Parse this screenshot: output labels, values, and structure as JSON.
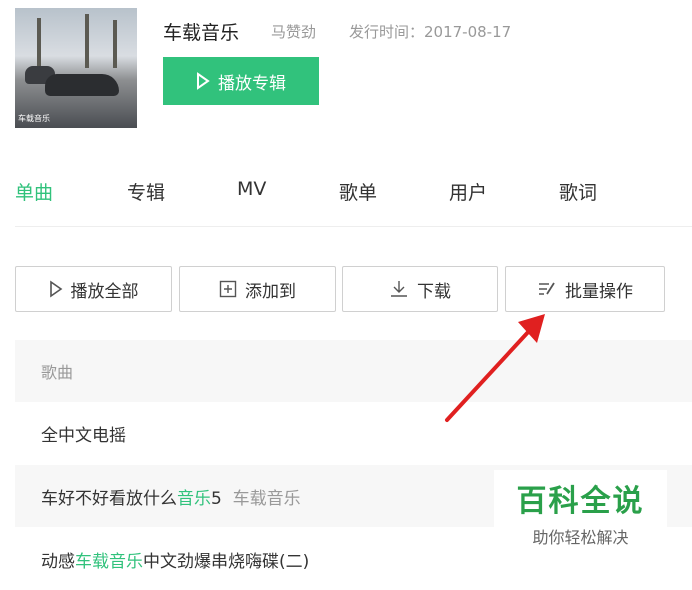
{
  "album": {
    "cover_caption": "车载音乐",
    "title": "车载音乐",
    "artist": "马赞劲",
    "release": "发行时间：2017-08-17",
    "play_label": "播放专辑"
  },
  "tabs": [
    {
      "label": "单曲",
      "active": true
    },
    {
      "label": "专辑"
    },
    {
      "label": "MV"
    },
    {
      "label": "歌单"
    },
    {
      "label": "用户"
    },
    {
      "label": "歌词"
    }
  ],
  "actions": {
    "play_all": "播放全部",
    "add_to": "添加到",
    "download": "下载",
    "batch": "批量操作"
  },
  "table": {
    "header": "歌曲",
    "rows": [
      {
        "title": "全中文电摇"
      },
      {
        "p1": "车好不好看放什么",
        "p2": "音乐",
        "p3": "5",
        "p4": "车载音乐"
      },
      {
        "p1": "动感",
        "p2": "车载音乐",
        "p3": "中文劲爆串烧嗨碟(二)"
      }
    ]
  },
  "watermark": {
    "title": "百科全说",
    "subtitle": "助你轻松解决"
  },
  "colors": {
    "accent": "#31c27c",
    "arrow": "#e02020"
  }
}
